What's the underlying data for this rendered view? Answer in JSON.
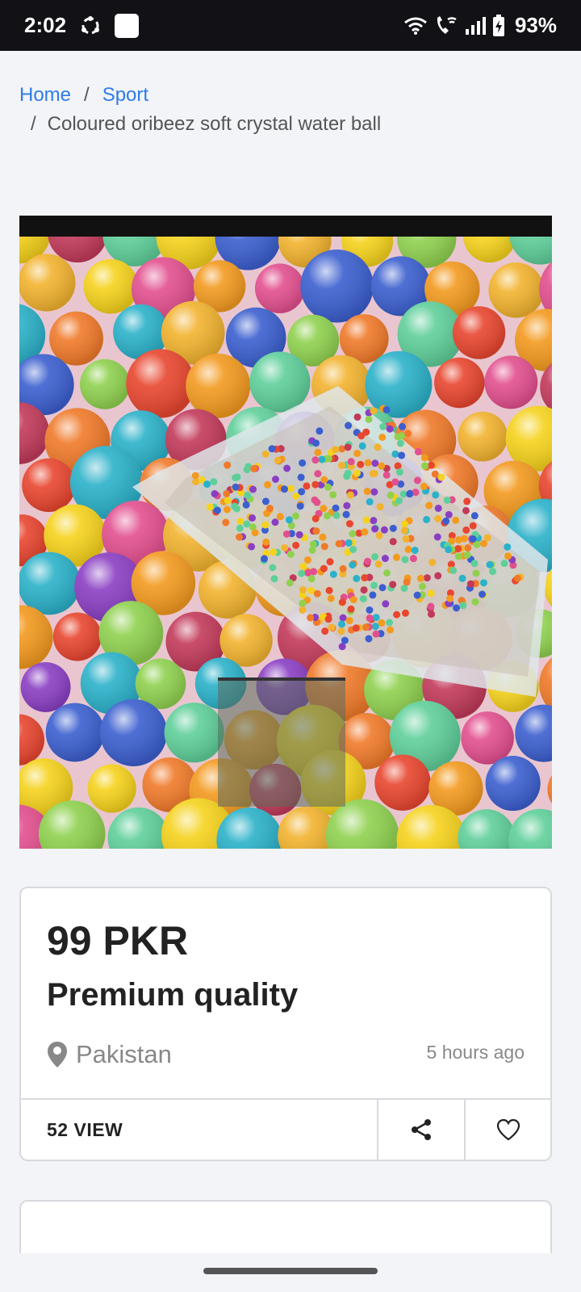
{
  "status_bar": {
    "time": "2:02",
    "battery": "93%",
    "icons": [
      "sync-icon",
      "app-square-icon",
      "wifi-icon",
      "wifi-call-icon",
      "signal-icon",
      "battery-charging-icon"
    ]
  },
  "breadcrumb": {
    "home": "Home",
    "separator": "/",
    "category": "Sport",
    "current": "Coloured oribeez soft crystal water ball"
  },
  "product": {
    "image_alt": "Colourful water gel beads with a small packet",
    "price": "99 PKR",
    "title": "Premium quality",
    "location": "Pakistan",
    "posted": "5 hours ago",
    "views": "52 VIEW"
  },
  "colors": {
    "link": "#2f7be8",
    "page_bg": "#f3f4f8",
    "card_border": "#d8d9de",
    "status_bar_bg": "#111116"
  }
}
